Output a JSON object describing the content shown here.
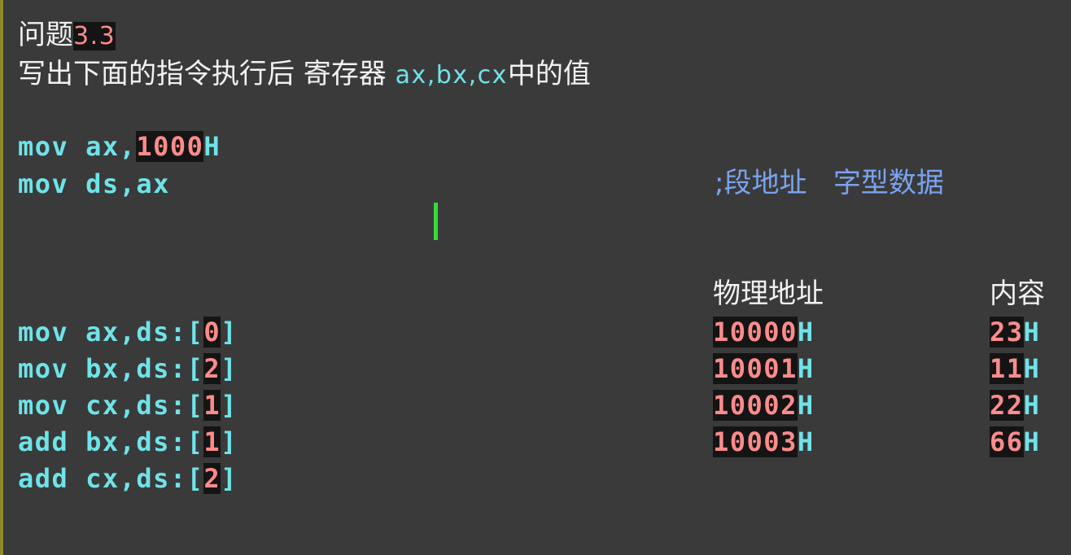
{
  "header": {
    "title_prefix": "问题",
    "title_number": "3.3",
    "subtitle_text": "写出下面的指令执行后 寄存器 ",
    "subtitle_regs": "ax,bx,cx",
    "subtitle_suffix": "中的值"
  },
  "code": {
    "line1": {
      "instr": "mov ax,",
      "num": "1000",
      "suffix": "H"
    },
    "line2": {
      "instr": "mov ds,ax"
    },
    "line3": {
      "instr": "mov ax,ds:[",
      "num": "0",
      "close": "]"
    },
    "line4": {
      "instr": "mov bx,ds:[",
      "num": "2",
      "close": "]"
    },
    "line5": {
      "instr": "mov cx,ds:[",
      "num": "1",
      "close": "]"
    },
    "line6": {
      "instr": "add bx,ds:[",
      "num": "1",
      "close": "]"
    },
    "line7": {
      "instr": "add cx,ds:[",
      "num": "2",
      "close": "]"
    }
  },
  "comment": {
    "text": ";段地址   字型数据"
  },
  "memory_table": {
    "header_address": "物理地址",
    "header_content": "内容",
    "rows": [
      {
        "address": "10000",
        "address_suffix": "H",
        "content": "23",
        "content_suffix": "H"
      },
      {
        "address": "10001",
        "address_suffix": "H",
        "content": "11",
        "content_suffix": "H"
      },
      {
        "address": "10002",
        "address_suffix": "H",
        "content": "22",
        "content_suffix": "H"
      },
      {
        "address": "10003",
        "address_suffix": "H",
        "content": "66",
        "content_suffix": "H"
      }
    ]
  },
  "colors": {
    "background": "#3a3a3a",
    "code_cyan": "#6fe3e8",
    "number_red": "#ff8b8b",
    "comment_blue": "#7aa3f0",
    "cursor_green": "#33dd33"
  }
}
